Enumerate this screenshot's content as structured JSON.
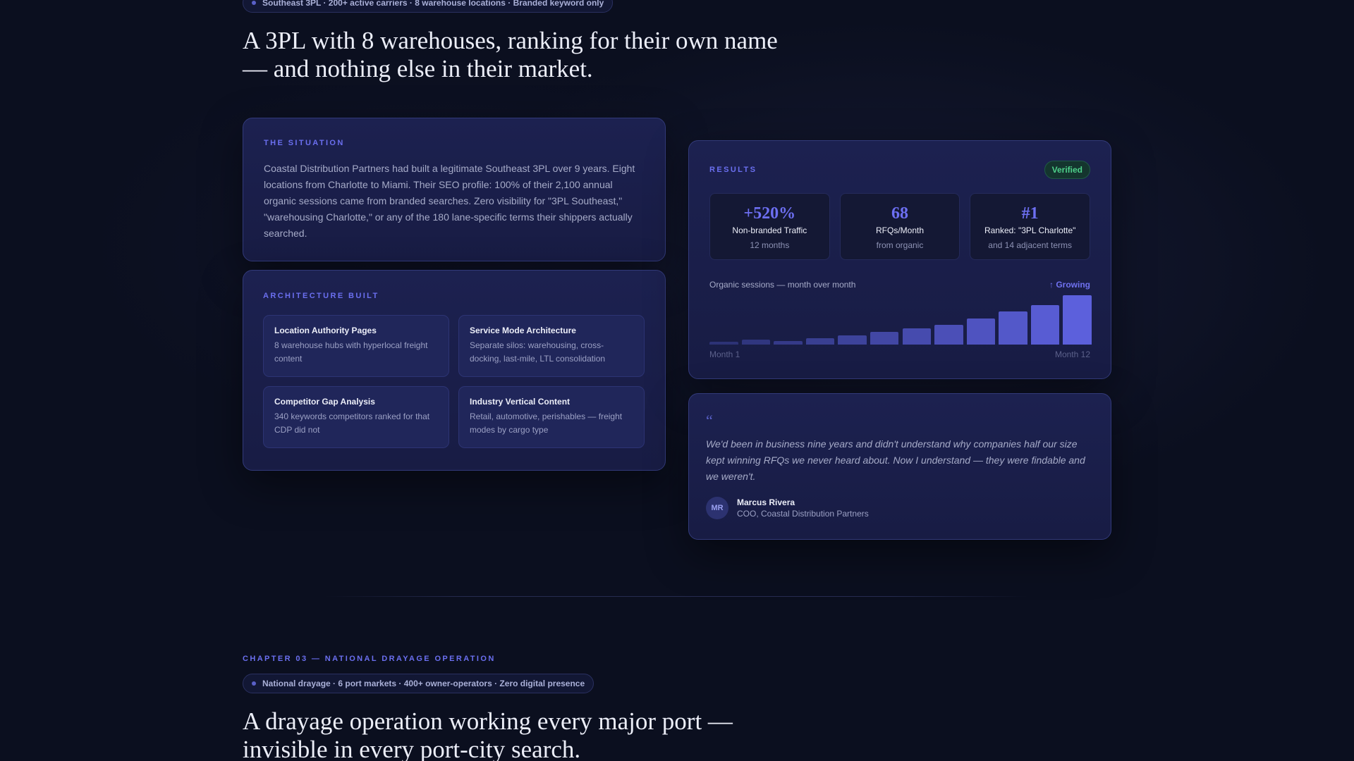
{
  "case1": {
    "pill": "Southeast 3PL · 200+ active carriers · 8 warehouse locations · Branded keyword only",
    "headline": "A 3PL with 8 warehouses, ranking for their own name — and nothing else in their market.",
    "situation": {
      "label": "THE SITUATION",
      "body": "Coastal Distribution Partners had built a legitimate Southeast 3PL over 9 years. Eight locations from Charlotte to Miami. Their SEO profile: 100% of their 2,100 annual organic sessions came from branded searches. Zero visibility for \"3PL Southeast,\" \"warehousing Charlotte,\" or any of the 180 lane-specific terms their shippers actually searched."
    },
    "architecture": {
      "label": "ARCHITECTURE BUILT",
      "items": [
        {
          "title": "Location Authority Pages",
          "desc": "8 warehouse hubs with hyperlocal freight content"
        },
        {
          "title": "Service Mode Architecture",
          "desc": "Separate silos: warehousing, cross-docking, last-mile, LTL consolidation"
        },
        {
          "title": "Competitor Gap Analysis",
          "desc": "340 keywords competitors ranked for that CDP did not"
        },
        {
          "title": "Industry Vertical Content",
          "desc": "Retail, automotive, perishables — freight modes by cargo type"
        }
      ]
    },
    "results": {
      "label": "RESULTS",
      "badge": "Verified",
      "metrics": [
        {
          "value": "+520%",
          "label": "Non-branded Traffic",
          "sub": "12 months"
        },
        {
          "value": "68",
          "label": "RFQs/Month",
          "sub": "from organic"
        },
        {
          "value": "#1",
          "label": "Ranked: \"3PL Charlotte\"",
          "sub": "and 14 adjacent terms"
        }
      ],
      "chart_title": "Organic sessions — month over month",
      "trend": "↑ Growing",
      "x_start": "Month 1",
      "x_end": "Month 12"
    },
    "testimonial": {
      "mark": "“",
      "quote": "We'd been in business nine years and didn't understand why companies half our size kept winning RFQs we never heard about. Now I understand — they were findable and we weren't.",
      "initials": "MR",
      "name": "Marcus Rivera",
      "role": "COO, Coastal Distribution Partners"
    }
  },
  "chart_data": {
    "type": "bar",
    "title": "Organic sessions — month over month",
    "categories": [
      "1",
      "2",
      "3",
      "4",
      "5",
      "6",
      "7",
      "8",
      "9",
      "10",
      "11",
      "12"
    ],
    "values": [
      4,
      7,
      5,
      9,
      13,
      18,
      22,
      27,
      36,
      46,
      54,
      68
    ],
    "ylim": [
      0,
      70
    ],
    "xlabel": "",
    "ylabel": "",
    "grid": false,
    "color_low": "#2c3276",
    "color_high": "#5c60dc"
  },
  "case2": {
    "chapter": "CHAPTER 03 — NATIONAL DRAYAGE OPERATION",
    "pill": "National drayage · 6 port markets · 400+ owner-operators · Zero digital presence",
    "headline": "A drayage operation working every major port — invisible in every port-city search."
  }
}
